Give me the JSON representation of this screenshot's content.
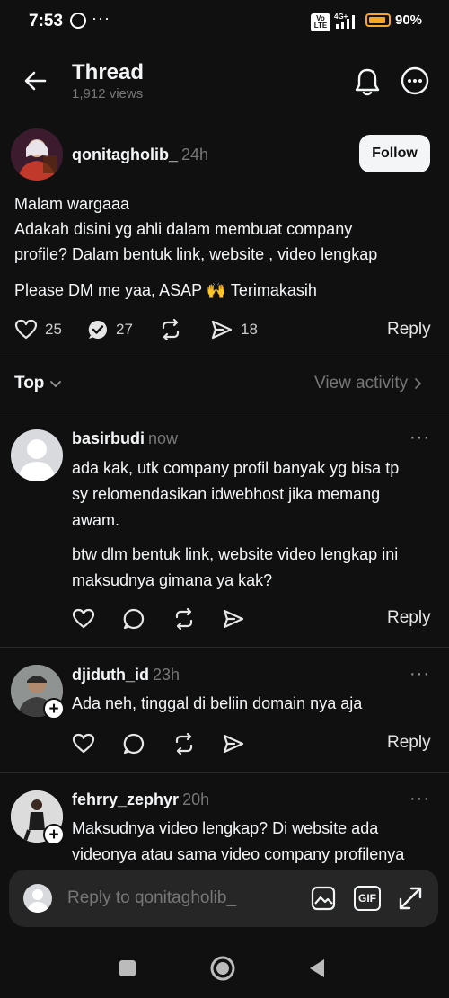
{
  "status_bar": {
    "time": "7:53",
    "more_notifications": "···",
    "volte": "Vo LTE",
    "network": "4G+",
    "battery": "90%",
    "battery_level": 0.9
  },
  "header": {
    "title": "Thread",
    "views": "1,912 views"
  },
  "post": {
    "username": "qonitagholib_",
    "time": "24h",
    "follow_label": "Follow",
    "line1": "Malam wargaaa",
    "line2": "Adakah disini yg ahli dalam membuat company",
    "line3": "profile? Dalam bentuk link, website , video lengkap",
    "line4": "Please DM me yaa, ASAP 🙌 Terimakasih",
    "likes": "25",
    "comments": "27",
    "shares": "18",
    "reply_label": "Reply"
  },
  "sort": {
    "label": "Top",
    "view_activity": "View activity"
  },
  "comments": [
    {
      "username": "basirbudi",
      "time": "now",
      "text1": "ada kak, utk company profil banyak yg bisa tp",
      "text2": "sy relomendasikan idwebhost jika memang",
      "text3": "awam.",
      "text4": "btw dlm bentuk link, website video lengkap ini",
      "text5": "maksudnya gimana ya kak?",
      "reply_label": "Reply"
    },
    {
      "username": "djiduth_id",
      "time": "23h",
      "text1": "Ada neh, tinggal di beliin domain nya aja",
      "reply_label": "Reply"
    },
    {
      "username": "fehrry_zephyr",
      "time": "20h",
      "text1": "Maksudnya video lengkap? Di website ada",
      "text2": "videonya atau sama video company profilenya"
    }
  ],
  "composer": {
    "placeholder": "Reply to qonitagholib_",
    "gif_label": "GIF"
  },
  "colors": {
    "background": "#101010",
    "text_primary": "#f3f5f7",
    "text_secondary": "#777777",
    "battery": "#f5a623"
  },
  "icons": [
    "whatsapp-icon",
    "back-arrow-icon",
    "bell-icon",
    "more-circle-icon",
    "heart-icon",
    "comment-check-icon",
    "repost-icon",
    "send-icon",
    "chevron-down-icon",
    "chevron-right-icon",
    "ellipsis-icon",
    "plus-icon",
    "image-icon",
    "gif-icon",
    "expand-icon",
    "nav-square-icon",
    "nav-home-icon",
    "nav-back-icon"
  ]
}
